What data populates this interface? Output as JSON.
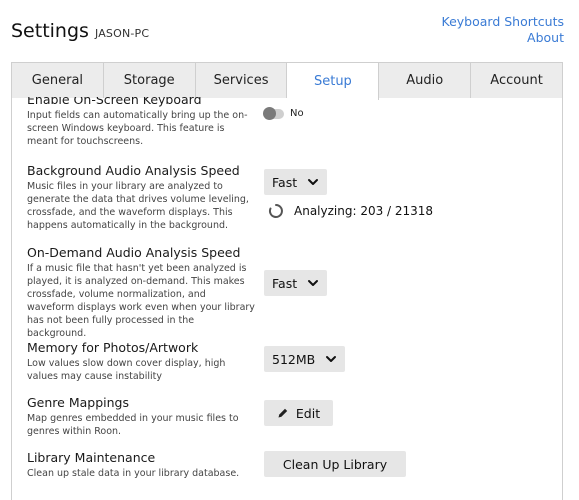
{
  "header": {
    "title": "Settings",
    "host": "JASON-PC",
    "links": [
      "Keyboard Shortcuts",
      "About"
    ]
  },
  "tabs": [
    {
      "label": "General",
      "active": false
    },
    {
      "label": "Storage",
      "active": false
    },
    {
      "label": "Services",
      "active": false
    },
    {
      "label": "Setup",
      "active": true
    },
    {
      "label": "Audio",
      "active": false
    },
    {
      "label": "Account",
      "active": false
    }
  ],
  "settings": {
    "onscreen_keyboard": {
      "label": "Enable On-Screen Keyboard",
      "desc": "Input fields can automatically bring up the on-screen Windows keyboard. This feature is meant for touchscreens.",
      "toggle_label": "No"
    },
    "bg_analysis": {
      "label": "Background Audio Analysis Speed",
      "desc": "Music files in your library are analyzed to generate the data that drives volume leveling, crossfade, and the waveform displays. This happens automatically in the background.",
      "value": "Fast",
      "status": "Analyzing: 203 / 21318"
    },
    "ondemand_analysis": {
      "label": "On-Demand Audio Analysis Speed",
      "desc": "If a music file that hasn't yet been analyzed is played, it is analyzed on-demand. This makes crossfade, volume normalization, and waveform displays work even when your library has not been fully processed in the background.",
      "value": "Fast"
    },
    "memory": {
      "label": "Memory for Photos/Artwork",
      "desc": "Low values slow down cover display, high values may cause instability",
      "value": "512MB"
    },
    "genre": {
      "label": "Genre Mappings",
      "desc": "Map genres embedded in your music files to genres within Roon.",
      "button": "Edit"
    },
    "maintenance": {
      "label": "Library Maintenance",
      "desc": "Clean up stale data in your library database.",
      "button": "Clean Up Library"
    }
  },
  "colors": {
    "accent": "#3a7bd5",
    "control_bg": "#e6e6e6"
  }
}
